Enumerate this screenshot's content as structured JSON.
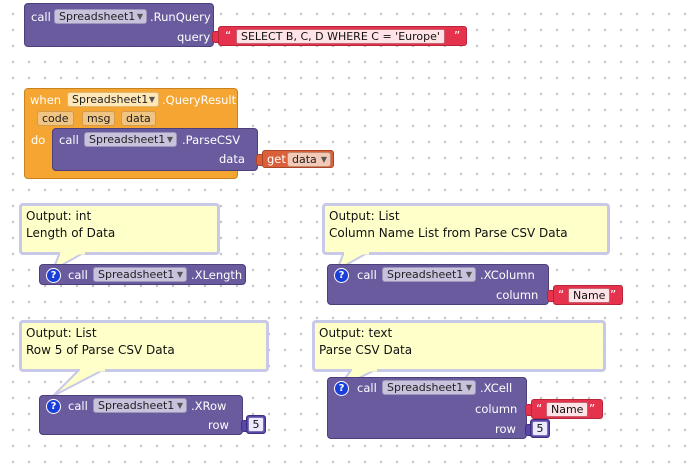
{
  "blocks": {
    "runquery": {
      "call": "call",
      "component": "Spreadsheet1",
      "method": ".RunQuery",
      "param": "query",
      "value": "SELECT B, C, D  WHERE C = 'Europe'"
    },
    "queryresult": {
      "when": "when",
      "component": "Spreadsheet1",
      "event": ".QueryResult",
      "args": [
        "code",
        "msg",
        "data"
      ],
      "do": "do"
    },
    "parsecsv": {
      "call": "call",
      "component": "Spreadsheet1",
      "method": ".ParseCSV",
      "param": "data",
      "get": "get",
      "get_var": "data"
    },
    "xlength": {
      "help": "?",
      "call": "call",
      "component": "Spreadsheet1",
      "method": ".XLength"
    },
    "xcolumn": {
      "help": "?",
      "call": "call",
      "component": "Spreadsheet1",
      "method": ".XColumn",
      "param": "column",
      "value": "Name"
    },
    "xrow": {
      "help": "?",
      "call": "call",
      "component": "Spreadsheet1",
      "method": ".XRow",
      "param": "row",
      "value": "5"
    },
    "xcell": {
      "help": "?",
      "call": "call",
      "component": "Spreadsheet1",
      "method": ".XCell",
      "param1": "column",
      "value1": "Name",
      "param2": "row",
      "value2": "5"
    }
  },
  "comments": {
    "xlength": {
      "line1": "Output: int",
      "line2": "Length of Data"
    },
    "xcolumn": {
      "line1": "Output: List",
      "line2": "Column Name List from Parse CSV Data"
    },
    "xrow": {
      "line1": "Output: List",
      "line2": "Row 5 of Parse CSV Data"
    },
    "xcell": {
      "line1": "Output: text",
      "line2": "Parse CSV Data"
    }
  },
  "colors": {
    "procedure": "#6a5a9e",
    "event": "#f5a531",
    "text": "#e5334e",
    "variable": "#d9603b",
    "number": "#5a46a8",
    "comment": "#ffffca",
    "help": "#1a3fd9"
  }
}
